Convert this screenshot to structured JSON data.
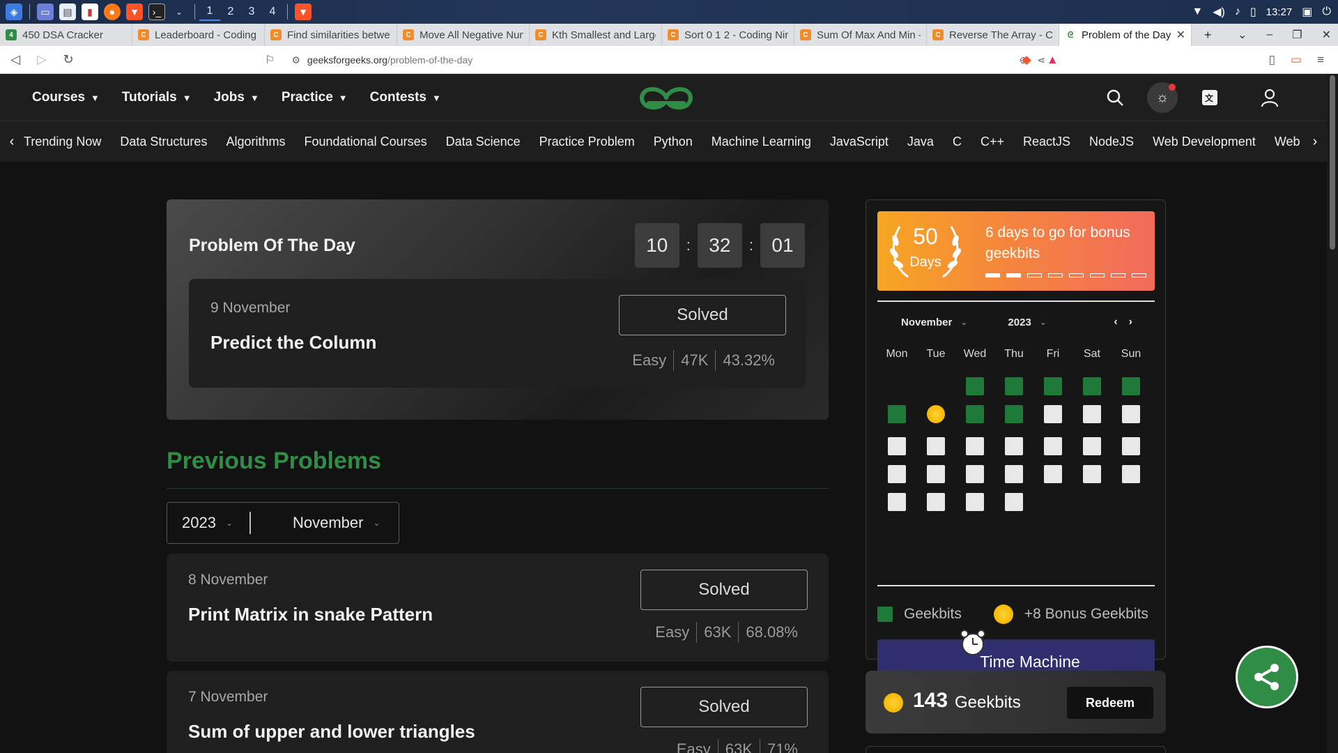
{
  "taskbar": {
    "workspaces": [
      "1",
      "2",
      "3",
      "4"
    ],
    "time": "13:27"
  },
  "browser": {
    "tabs": [
      {
        "title": "450 DSA Cracker",
        "icon": "sheets-icon"
      },
      {
        "title": "Leaderboard - Coding",
        "icon": "codingninjas-icon"
      },
      {
        "title": "Find similarities betwe",
        "icon": "codingninjas-icon"
      },
      {
        "title": "Move All Negative Nun",
        "icon": "codingninjas-icon"
      },
      {
        "title": "Kth Smallest and Large",
        "icon": "codingninjas-icon"
      },
      {
        "title": "Sort 0 1 2 - Coding Nin",
        "icon": "codingninjas-icon"
      },
      {
        "title": "Sum Of Max And Min -",
        "icon": "codingninjas-icon"
      },
      {
        "title": "Reverse The Array - Co",
        "icon": "codingninjas-icon"
      },
      {
        "title": "Problem of the Day",
        "icon": "gfg-icon"
      }
    ],
    "url": "geeksforgeeks.org/problem-of-the-day",
    "url_domain": "geeksforgeeks.org",
    "url_path": "/problem-of-the-day"
  },
  "header": {
    "menu": [
      "Courses",
      "Tutorials",
      "Jobs",
      "Practice",
      "Contests"
    ]
  },
  "subnav": [
    "Trending Now",
    "Data Structures",
    "Algorithms",
    "Foundational Courses",
    "Data Science",
    "Practice Problem",
    "Python",
    "Machine Learning",
    "JavaScript",
    "Java",
    "C",
    "C++",
    "ReactJS",
    "NodeJS",
    "Web Development",
    "Web D"
  ],
  "potd": {
    "title": "Problem Of The Day",
    "timer": {
      "hours": "10",
      "minutes": "32",
      "seconds": "01"
    },
    "date": "9 November",
    "name": "Predict the Column",
    "status": "Solved",
    "difficulty": "Easy",
    "submissions": "47K",
    "accuracy": "43.32%"
  },
  "previous": {
    "title": "Previous Problems",
    "year": "2023",
    "month": "November",
    "items": [
      {
        "date": "8 November",
        "name": "Print Matrix in snake Pattern",
        "status": "Solved",
        "difficulty": "Easy",
        "submissions": "63K",
        "accuracy": "68.08%"
      },
      {
        "date": "7 November",
        "name": "Sum of upper and lower triangles",
        "status": "Solved",
        "difficulty": "Easy",
        "submissions": "63K",
        "accuracy": "71%"
      }
    ]
  },
  "streak": {
    "days_num": "50",
    "days_label": "Days",
    "bonus_text": "6 days to go for bonus geekbits",
    "progress_total": 8,
    "progress_done": 2
  },
  "calendar": {
    "month": "November",
    "year": "2023",
    "weekdays": [
      "Mon",
      "Tue",
      "Wed",
      "Thu",
      "Fri",
      "Sat",
      "Sun"
    ],
    "first_weekday_index": 2,
    "days_in_month": 30,
    "completed_days": [
      1,
      2,
      3,
      4,
      5,
      6,
      8,
      9
    ],
    "bonus_day": 7
  },
  "legend": {
    "geekbits": "Geekbits",
    "bonus": "+8 Bonus Geekbits"
  },
  "time_machine": "Time Machine",
  "geekbits": {
    "count": "143",
    "label": "Geekbits",
    "redeem": "Redeem"
  },
  "colors": {
    "accent_green": "#2f8d46",
    "streak_gradient_start": "#f6a623",
    "streak_gradient_end": "#f26b5b",
    "time_machine": "#2f2e6e"
  }
}
